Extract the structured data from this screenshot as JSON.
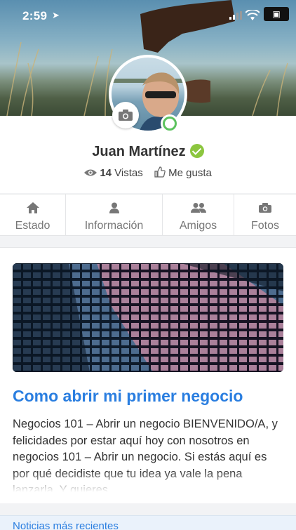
{
  "status_bar": {
    "time": "2:59"
  },
  "profile": {
    "name": "Juan Martínez",
    "views_count": "14",
    "views_label": "Vistas",
    "likes_label": "Me gusta"
  },
  "tabs": [
    {
      "label": "Estado",
      "icon": "home-icon"
    },
    {
      "label": "Información",
      "icon": "user-icon"
    },
    {
      "label": "Amigos",
      "icon": "users-icon"
    },
    {
      "label": "Fotos",
      "icon": "camera-icon"
    }
  ],
  "post": {
    "title": "Como abrir mi primer negocio",
    "body": "Negocios 101 – Abrir un negocio BIENVENIDO/A, y felicidades por estar aquí hoy con nosotros en negocios 101 – Abrir un negocio. Si estás aquí es por qué decidiste que tu idea ya vale la pena lanzarla. Y quieres"
  },
  "next_post": {
    "label": "Noticias más recientes"
  },
  "colors": {
    "accent": "#2a7ee0",
    "verified": "#8cc63f",
    "online": "#5cc25e"
  }
}
